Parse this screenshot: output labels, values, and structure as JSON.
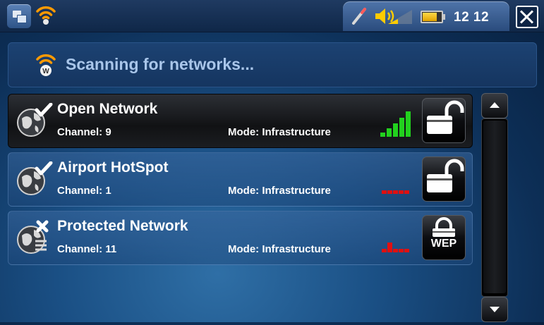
{
  "status_bar": {
    "time": "12 12",
    "battery_level": 0.75,
    "icons": [
      "home-icon",
      "wifi-icon",
      "pen-icon",
      "speaker-icon",
      "battery-icon",
      "close-icon"
    ]
  },
  "scan": {
    "message": "Scanning for networks...",
    "icon": "wifi-w-icon"
  },
  "networks": [
    {
      "name": "Open Network",
      "channel": "Channel: 9",
      "mode": "Mode: Infrastructure",
      "signal_bars": 5,
      "signal_color": "#22d11e",
      "security": "open",
      "status": "check",
      "selected": true
    },
    {
      "name": "Airport HotSpot",
      "channel": "Channel: 1",
      "mode": "Mode: Infrastructure",
      "signal_bars": 0,
      "signal_color": "#e01010",
      "security": "open",
      "status": "check",
      "selected": false
    },
    {
      "name": "Protected Network",
      "channel": "Channel: 11",
      "mode": "Mode: Infrastructure",
      "signal_bars": 2,
      "signal_color": "#e01010",
      "security": "WEP",
      "status": "cross",
      "selected": false
    }
  ],
  "colors": {
    "accent": "#2f6fa6",
    "scan_text": "#a9c6ea",
    "signal_good": "#22d11e",
    "signal_bad": "#e01010",
    "wifi_orange": "#ff9a00"
  }
}
